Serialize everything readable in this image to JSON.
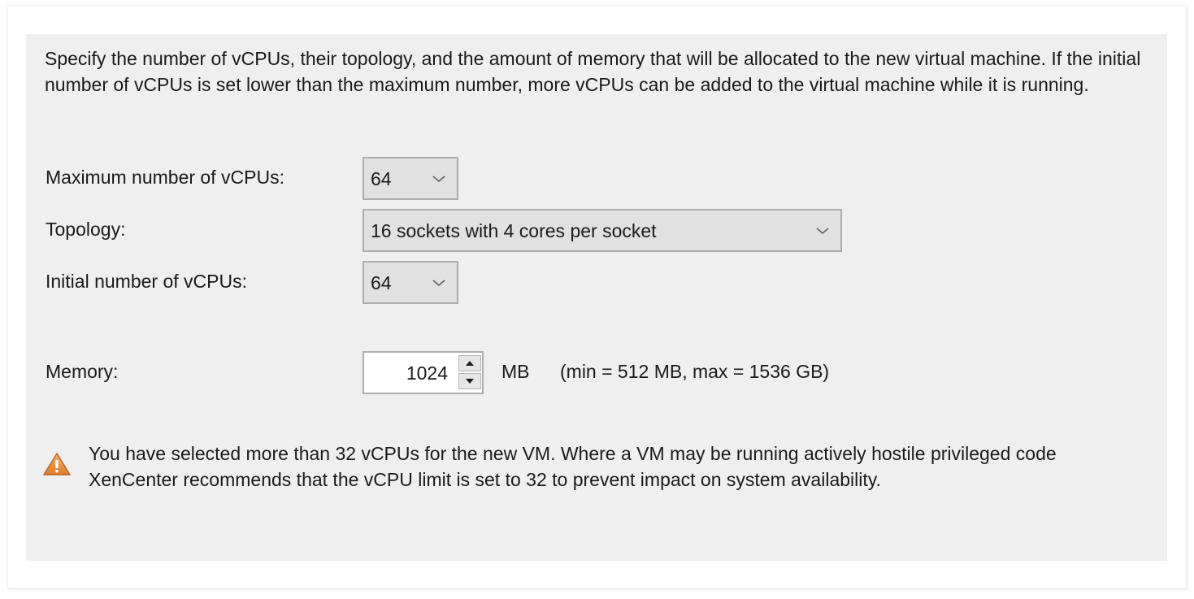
{
  "intro_text": "Specify the number of vCPUs, their topology, and the amount of memory that will be allocated to the new virtual machine. If the initial number of vCPUs is set lower than the maximum number, more vCPUs can be added to the virtual machine while it is running.",
  "fields": {
    "max_vcpus": {
      "label": "Maximum number of vCPUs:",
      "value": "64",
      "icon": "chevron-down-icon"
    },
    "topology": {
      "label": "Topology:",
      "value": "16 sockets with 4 cores per socket",
      "icon": "chevron-down-icon"
    },
    "initial_vcpus": {
      "label": "Initial number of vCPUs:",
      "value": "64",
      "icon": "chevron-down-icon"
    },
    "memory": {
      "label": "Memory:",
      "value": "1024",
      "unit": "MB",
      "range": "(min = 512 MB, max = 1536 GB)",
      "spin_up_icon": "triangle-up-icon",
      "spin_down_icon": "triangle-down-icon"
    }
  },
  "warning": {
    "icon": "warning-triangle-icon",
    "text": "You have selected more than 32 vCPUs for the new VM. Where a VM may be running actively hostile privileged code XenCenter recommends that the vCPU limit is set to 32 to prevent impact on system availability.",
    "icon_color": "#e8913a"
  },
  "colors": {
    "panel_bg": "#efefef",
    "combo_bg": "#e1e1e1",
    "border": "#adadad"
  }
}
